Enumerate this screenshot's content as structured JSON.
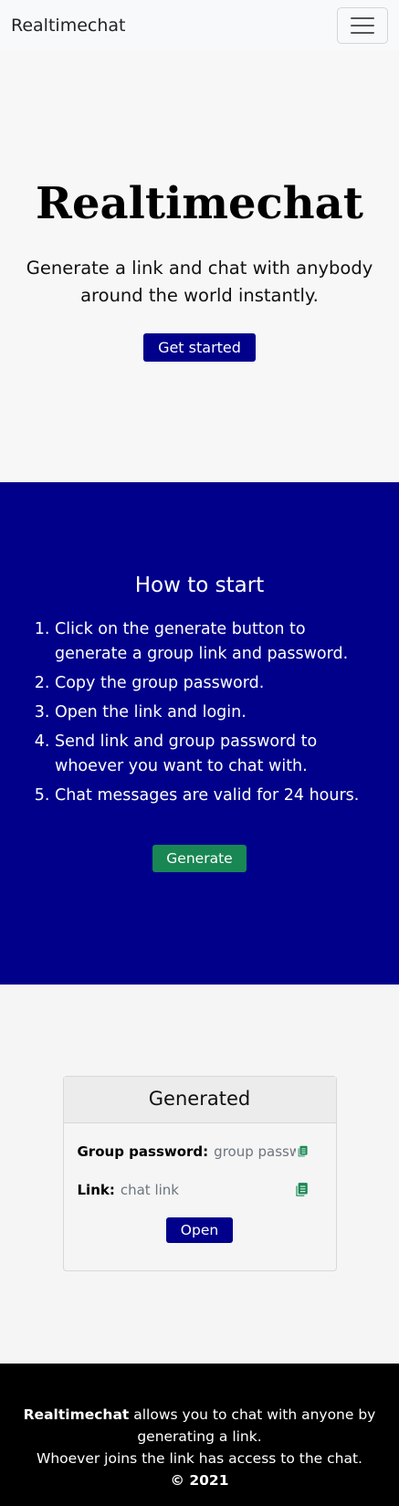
{
  "navbar": {
    "brand": "Realtimechat"
  },
  "hero": {
    "title": "Realtimechat",
    "subtitle": "Generate a link and chat with anybody around the world instantly.",
    "cta": "Get started"
  },
  "howto": {
    "heading": "How to start",
    "steps": [
      "Click on the generate button to generate a group link and password.",
      "Copy the group password.",
      "Open the link and login.",
      "Send link and group password to whoever you want to chat with.",
      "Chat messages are valid for 24 hours."
    ],
    "generate_label": "Generate"
  },
  "generated": {
    "header": "Generated",
    "password_label": "Group password:",
    "password_placeholder": "group password",
    "link_label": "Link:",
    "link_placeholder": "chat link",
    "open_label": "Open"
  },
  "footer": {
    "brand": "Realtimechat",
    "line1_rest": " allows you to chat with anyone by generating a link.",
    "line2": "Whoever joins the link has access to the chat.",
    "copyright": "© 2021"
  },
  "colors": {
    "primary": "#00008b",
    "success": "#198754",
    "footer_bg": "#000000"
  }
}
